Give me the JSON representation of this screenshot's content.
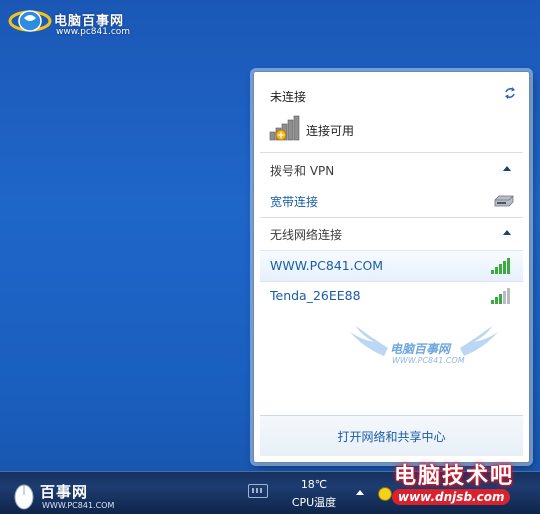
{
  "watermark_top": {
    "title": "电脑百事网",
    "url": "www.pc841.com"
  },
  "panel": {
    "status_title": "未连接",
    "status_detail": "连接可用",
    "section_dialup": {
      "title": "拨号和 VPN",
      "items": [
        {
          "label": "宽带连接",
          "icon": "modem-icon"
        }
      ]
    },
    "section_wireless": {
      "title": "无线网络连接",
      "networks": [
        {
          "ssid": "WWW.PC841.COM",
          "signal": 5,
          "highlighted": true
        },
        {
          "ssid": "Tenda_26EE88",
          "signal": 3,
          "highlighted": false
        }
      ]
    },
    "watermark": {
      "title": "电脑百事网",
      "url": "WWW.PC841.COM"
    },
    "footer_link": "打开网络和共享中心"
  },
  "taskbar": {
    "logo_title": "百事网",
    "logo_url": "WWW.PC841.COM",
    "temperature": "18℃",
    "cpu_label": "CPU温度"
  },
  "watermark_corner": {
    "title": "电脑技术吧",
    "url": "www.dnjsb.com"
  },
  "colors": {
    "link": "#1a5da8",
    "signal_green": "#3bab3b",
    "desktop": "#1f66c9"
  }
}
